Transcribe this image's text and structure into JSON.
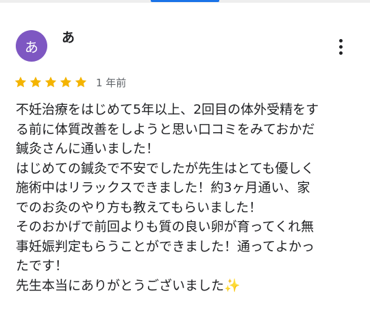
{
  "reviewer": {
    "avatar_initial": "あ",
    "avatar_color": "#7e57c2",
    "name": "あ"
  },
  "rating": {
    "stars": 5,
    "max_stars": 5,
    "star_color": "#f4b400"
  },
  "timestamp": "1 年前",
  "review_lines": [
    "不妊治療をはじめて5年以上、2回目の体外受精をす",
    "る前に体質改善をしようと思い口コミをみておかだ",
    "鍼灸さんに通いました！",
    "はじめての鍼灸で不安でしたが先生はとても優しく",
    "施術中はリラックスできました！約3ヶ月通い、家",
    "でのお灸のやり方も教えてもらいました！",
    "そのおかげで前回よりも質の良い卵が育ってくれ無",
    "事妊娠判定もらうことができました！通ってよかっ",
    "たです！",
    "先生本当にありがとうございました"
  ],
  "review_emoji": "✨"
}
